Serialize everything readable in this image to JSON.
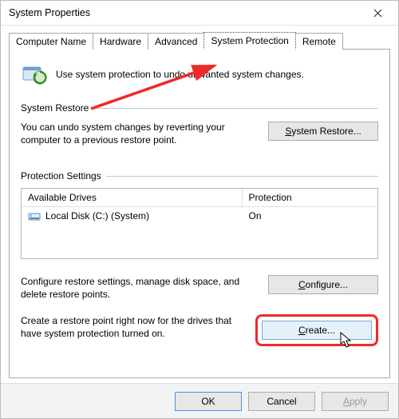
{
  "window": {
    "title": "System Properties"
  },
  "tabs": [
    {
      "label": "Computer Name"
    },
    {
      "label": "Hardware"
    },
    {
      "label": "Advanced"
    },
    {
      "label": "System Protection",
      "active": true
    },
    {
      "label": "Remote"
    }
  ],
  "intro": {
    "text": "Use system protection to undo unwanted system changes."
  },
  "systemRestore": {
    "groupLabel": "System Restore",
    "text": "You can undo system changes by reverting your computer to a previous restore point.",
    "buttonPrefix": "S",
    "buttonRest": "ystem Restore..."
  },
  "protectionSettings": {
    "groupLabel": "Protection Settings",
    "headers": {
      "drives": "Available Drives",
      "protection": "Protection"
    },
    "rows": [
      {
        "drive": "Local Disk (C:) (System)",
        "protection": "On"
      }
    ],
    "configure": {
      "text": "Configure restore settings, manage disk space, and delete restore points.",
      "buttonPrefix": "C",
      "buttonRest": "onfigure..."
    },
    "create": {
      "text": "Create a restore point right now for the drives that have system protection turned on.",
      "buttonPrefix": "C",
      "buttonRest": "reate..."
    }
  },
  "bottomButtons": {
    "ok": "OK",
    "cancel": "Cancel",
    "applyPrefix": "A",
    "applyRest": "pply"
  }
}
